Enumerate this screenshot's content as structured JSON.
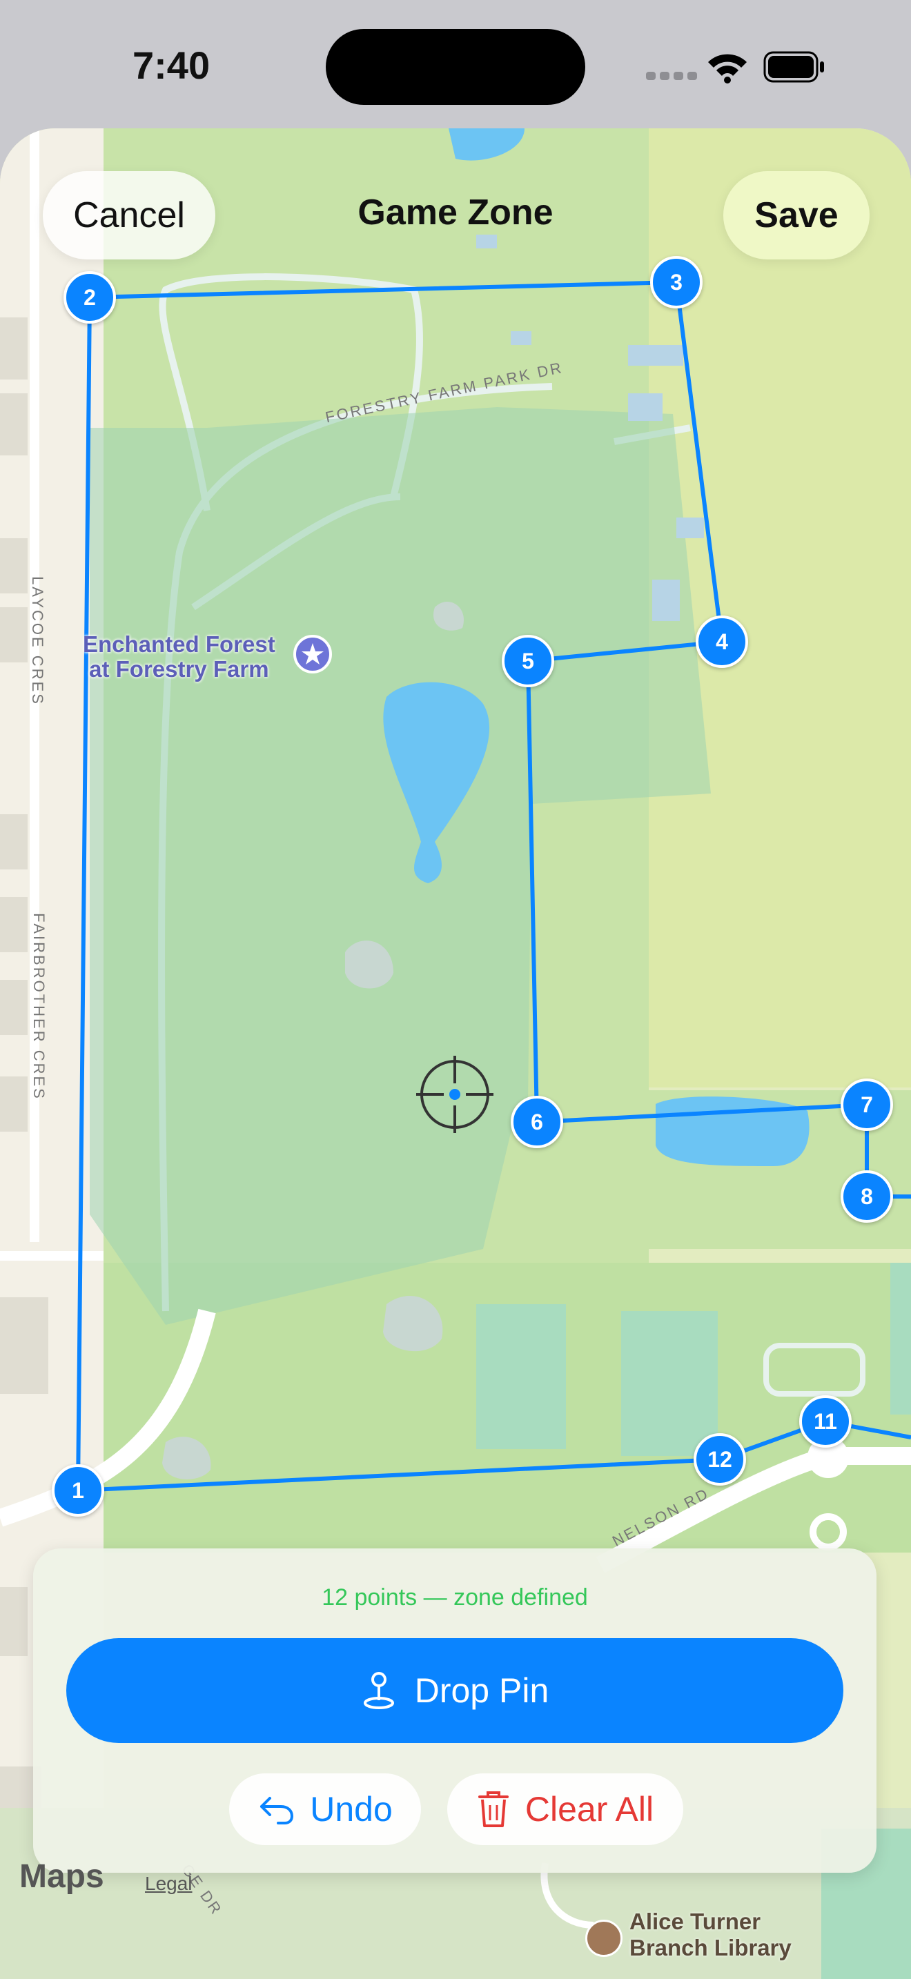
{
  "status_bar": {
    "time": "7:40"
  },
  "header": {
    "cancel_label": "Cancel",
    "title": "Game Zone",
    "save_label": "Save"
  },
  "map": {
    "poi_label": "Enchanted Forest\nat Forestry Farm",
    "street_labels": [
      "FORESTRY FARM PARK DR",
      "LAYCOE CRES",
      "FAIRBROTHER CRES",
      "NELSON RD",
      "GE DR"
    ],
    "library_label": "Alice Turner\nBranch Library",
    "maps_logo": "Maps",
    "legal_label": "Legal",
    "pins": [
      "1",
      "2",
      "3",
      "4",
      "5",
      "6",
      "7",
      "8",
      "11",
      "12"
    ]
  },
  "panel": {
    "status": "12 points — zone defined",
    "drop_pin_label": "Drop Pin",
    "undo_label": "Undo",
    "clear_all_label": "Clear All"
  },
  "colors": {
    "accent": "#0a84ff",
    "success": "#34c759",
    "danger": "#e53935"
  }
}
